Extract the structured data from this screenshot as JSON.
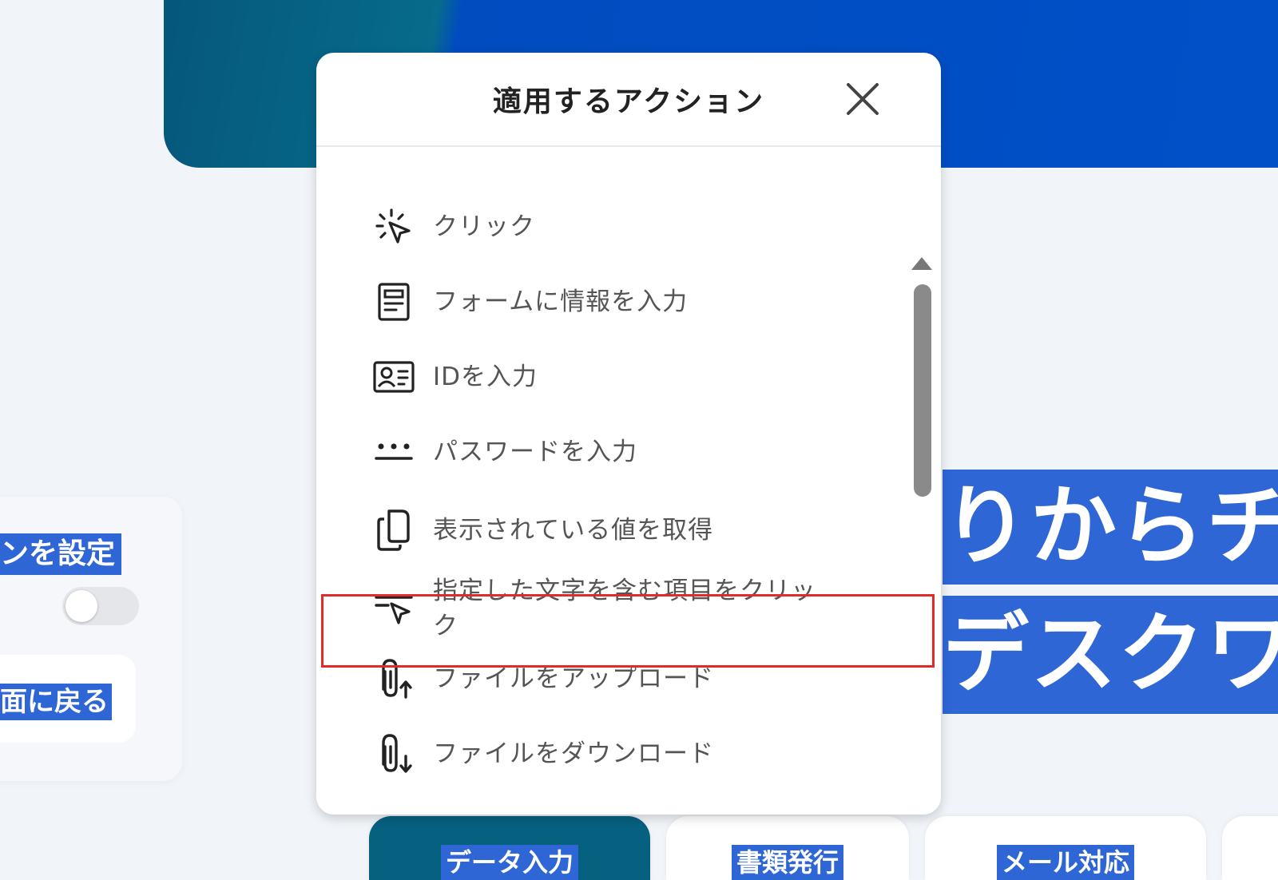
{
  "background": {
    "left_card_label": "ンを設定",
    "back_label": "面に戻る",
    "big_text_line1": "りからチ",
    "big_text_line2": "デスクワ",
    "bottom_tabs": [
      "データ入力",
      "書類発行",
      "メール対応",
      ""
    ]
  },
  "modal": {
    "title": "適用するアクション",
    "items": [
      {
        "label": "クリック",
        "icon": "click-pointer-icon"
      },
      {
        "label": "フォームに情報を入力",
        "icon": "form-document-icon"
      },
      {
        "label": "IDを入力",
        "icon": "id-card-icon"
      },
      {
        "label": "パスワードを入力",
        "icon": "password-dots-icon"
      },
      {
        "label": "表示されている値を取得",
        "icon": "copy-icon"
      },
      {
        "label": "指定した文字を含む項目をクリック",
        "icon": "text-filter-click-icon"
      },
      {
        "label": "ファイルをアップロード",
        "icon": "paperclip-upload-icon"
      },
      {
        "label": "ファイルをダウンロード",
        "icon": "paperclip-download-icon"
      }
    ],
    "highlighted_index": 4
  },
  "colors": {
    "highlight_border": "#e02b27",
    "text_highlight": "#2f66d6",
    "hero_teal": "#05577a",
    "hero_blue": "#0050c8"
  }
}
